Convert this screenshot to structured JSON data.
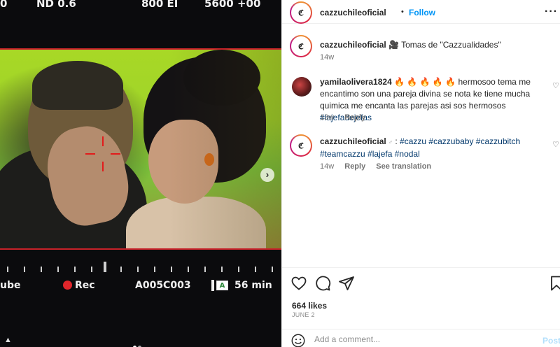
{
  "media": {
    "cam_top": {
      "left": "0",
      "center": "ND 0.6",
      "mid": "800 EI",
      "right": "5600 +00"
    },
    "cam_bottom": {
      "left": "ube",
      "rec": "Rec",
      "clip": "A005C003",
      "battery_glyph": "A",
      "time": "56 min"
    },
    "next_icon": "chevron-right-icon"
  },
  "post": {
    "author": "cazzuchileoficial",
    "follow_label": "Follow",
    "separator": "•",
    "more_label": "···",
    "caption": {
      "user": "cazzuchileoficial",
      "emoji": "🎥",
      "text": "Tomas de \"Cazzualidades\"",
      "time": "14w"
    },
    "comments": [
      {
        "user": "yamilaolivera1824",
        "emoji": "🔥 🔥 🔥 🔥 🔥",
        "text": "hermosoo tema me encantimo son una pareja divina se nota ke tiene mucha quimica me encanta las parejas asi sos hermosos",
        "tag": "#lajefadejefas",
        "time": "13w",
        "reply": "Reply"
      },
      {
        "user": "cazzuchileoficial",
        "emoji": "♂",
        "sep": ":",
        "tags_line1": "#cazzu #cazzubaby #cazzubitch",
        "tags_line2": "#teamcazzu #lajefa #nodal",
        "time": "14w",
        "reply": "Reply",
        "translate": "See translation"
      }
    ],
    "likes": "664 likes",
    "date": "JUNE 2",
    "comment_placeholder": "Add a comment...",
    "post_label": "Post"
  },
  "colors": {
    "accent": "#0095f6",
    "link": "#00376b",
    "rec": "#e0262b"
  }
}
